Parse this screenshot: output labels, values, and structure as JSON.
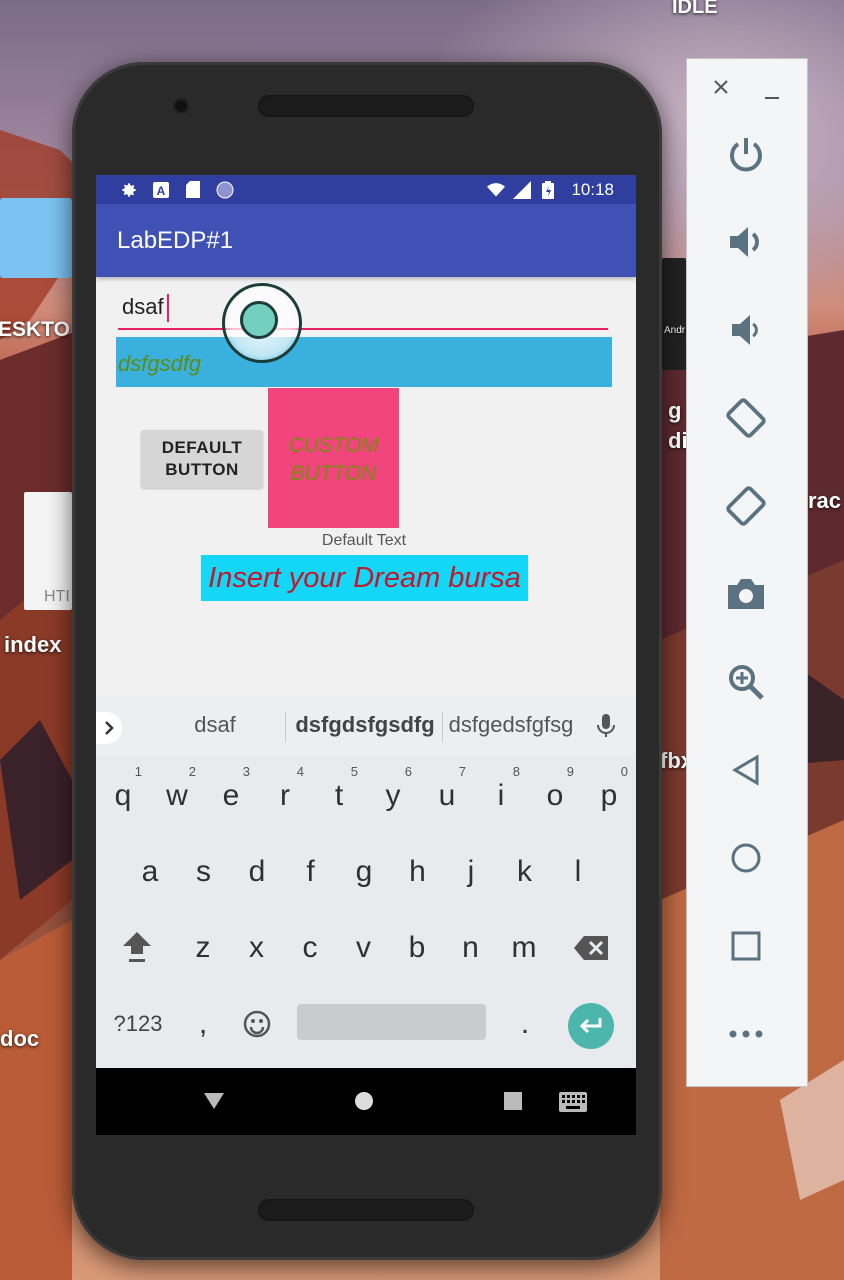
{
  "desktop": {
    "labels": [
      "IDLE",
      "ESKTO",
      "index",
      "doc",
      "HTI",
      "g",
      "di",
      "fbx",
      "rac",
      "Andr"
    ]
  },
  "app": {
    "title": "LabEDP#1",
    "status_time": "10:18",
    "edit_value": "dsaf",
    "blue_text": "dsfgsdfg",
    "default_button": "DEFAULT\nBUTTON",
    "custom_button": "CUSTOM\nBUTTON",
    "default_text": "Default Text",
    "dream_text": "Insert your Dream bursa"
  },
  "keyboard": {
    "suggestions": [
      "dsaf",
      "dsfgdsfgsdfg",
      "dsfgedsfgfsg"
    ],
    "row1": [
      {
        "k": "q",
        "n": "1"
      },
      {
        "k": "w",
        "n": "2"
      },
      {
        "k": "e",
        "n": "3"
      },
      {
        "k": "r",
        "n": "4"
      },
      {
        "k": "t",
        "n": "5"
      },
      {
        "k": "y",
        "n": "6"
      },
      {
        "k": "u",
        "n": "7"
      },
      {
        "k": "i",
        "n": "8"
      },
      {
        "k": "o",
        "n": "9"
      },
      {
        "k": "p",
        "n": "0"
      }
    ],
    "row2": [
      "a",
      "s",
      "d",
      "f",
      "g",
      "h",
      "j",
      "k",
      "l"
    ],
    "row3": [
      "z",
      "x",
      "c",
      "v",
      "b",
      "n",
      "m"
    ],
    "symbols_label": "?123",
    "comma": ",",
    "period": "."
  },
  "icons": {
    "statusbar": [
      "settings-icon",
      "a-icon",
      "sd-card-icon",
      "circle-icon",
      "wifi-icon",
      "signal-icon",
      "battery-icon"
    ],
    "navbar": [
      "back-icon",
      "home-icon",
      "recents-icon",
      "keyboard-icon"
    ],
    "emulator": [
      "close-icon",
      "minimize-icon",
      "power-icon",
      "volume-up-icon",
      "volume-down-icon",
      "rotate-left-icon",
      "rotate-right-icon",
      "camera-icon",
      "zoom-icon",
      "back-icon",
      "home-icon",
      "overview-icon",
      "more-icon"
    ]
  },
  "colors": {
    "statusbar": "#303f9f",
    "appbar": "#3f51b5",
    "accent": "#e91e63",
    "blue_text_bg": "#39b0de",
    "custom_button_bg": "#f2447d",
    "dream_bg": "#14d6f7",
    "dream_text": "#c2182c",
    "enter_key": "#4db6ac"
  }
}
